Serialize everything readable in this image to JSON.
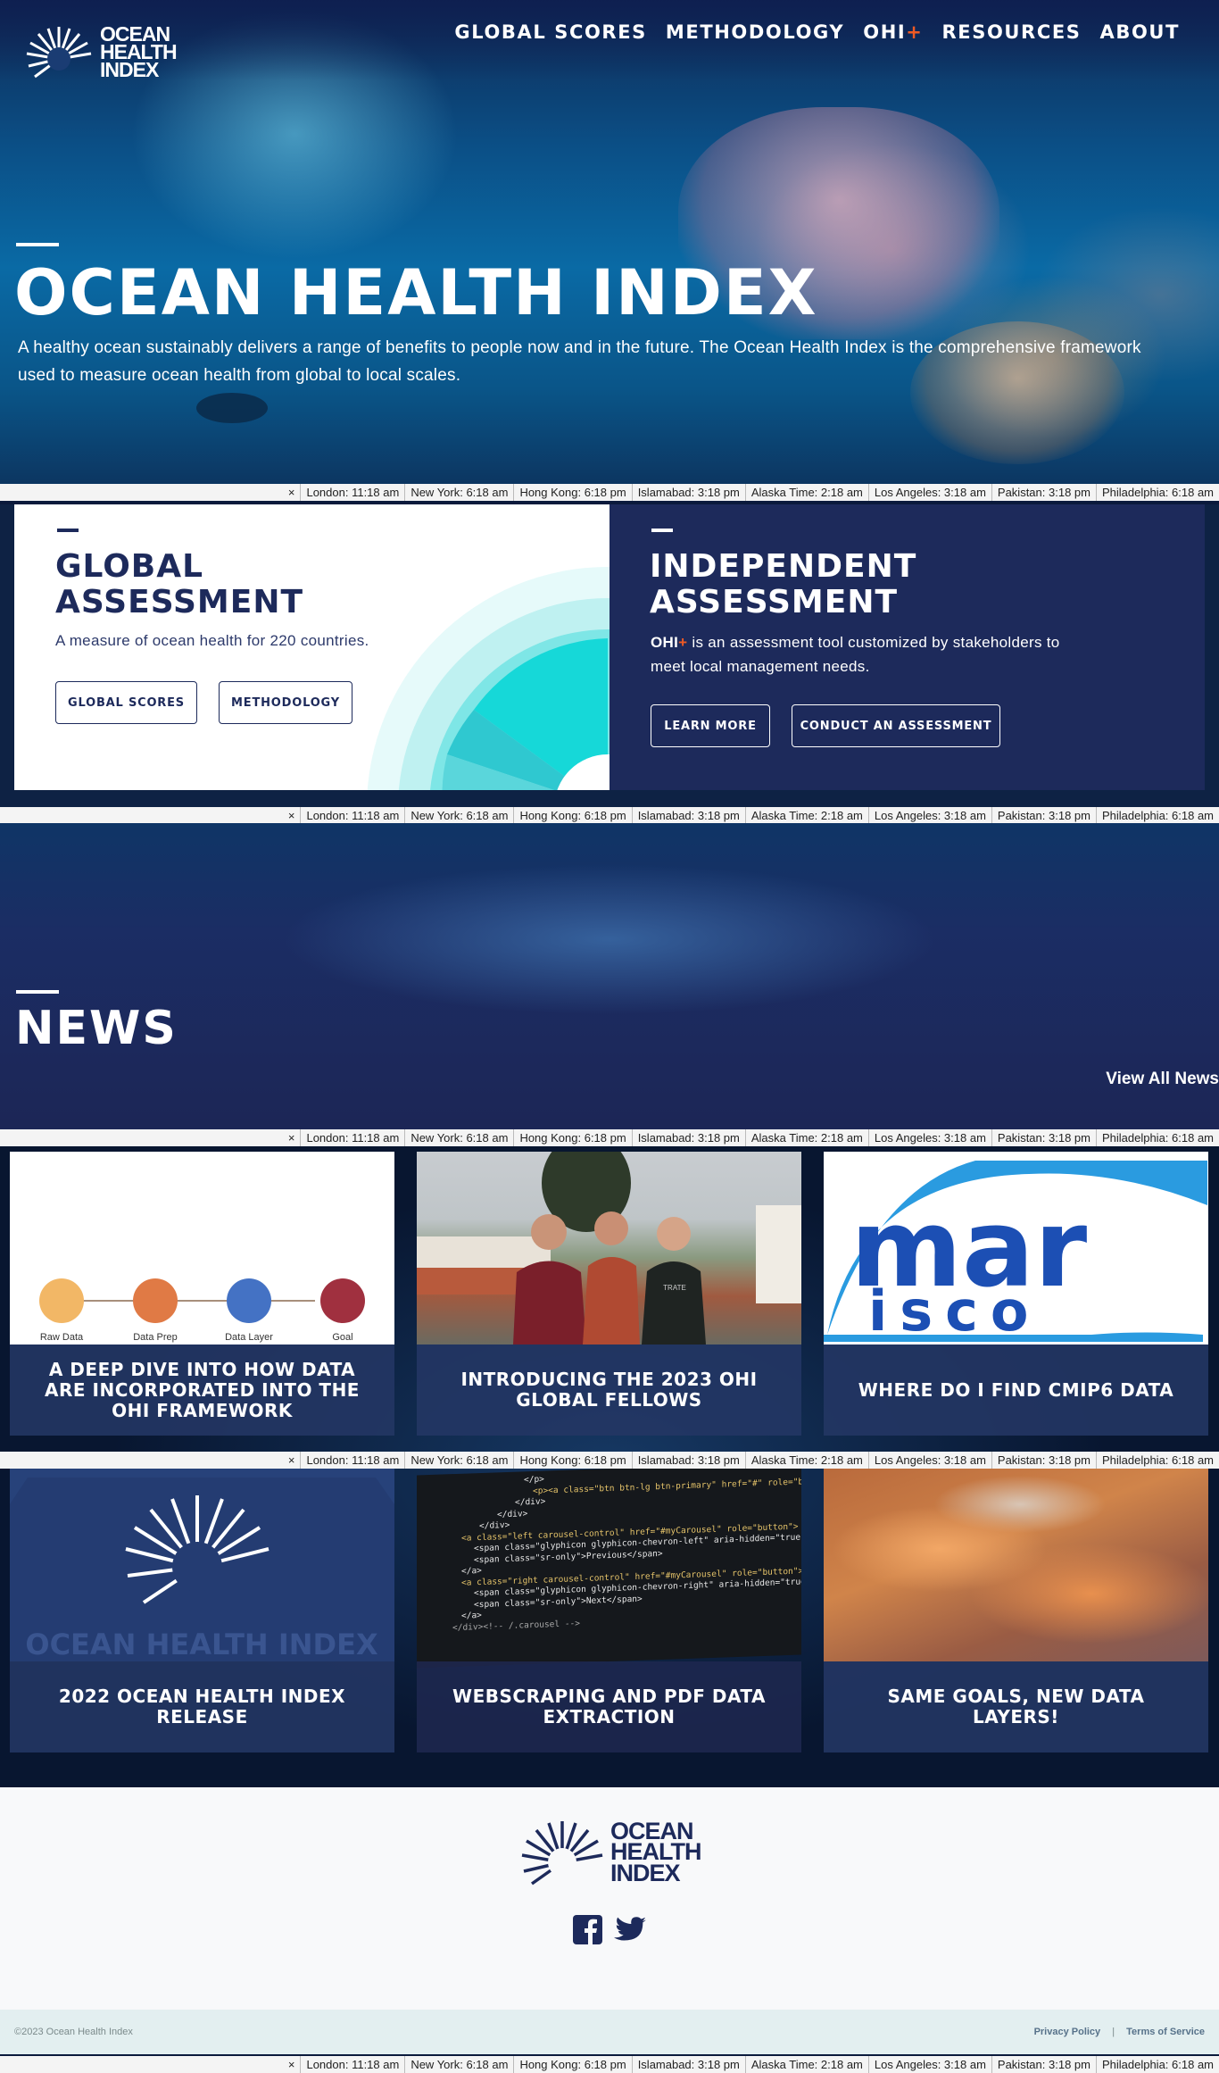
{
  "brand": {
    "logo_line1": "OCEAN",
    "logo_line2": "HEALTH",
    "logo_line3": "INDEX"
  },
  "nav": {
    "items": [
      "GLOBAL SCORES",
      "METHODOLOGY",
      "OHI",
      "RESOURCES",
      "ABOUT"
    ],
    "plus": "+"
  },
  "hero": {
    "title": "OCEAN HEALTH INDEX",
    "text": "A healthy ocean sustainably delivers a range of benefits to people now and in the future. The Ocean Health Index is the comprehensive framework used to measure ocean health from global to local scales."
  },
  "ticker": {
    "close": "×",
    "items": [
      "London: 11:18 am",
      "New York: 6:18 am",
      "Hong Kong: 6:18 pm",
      "Islamabad: 3:18 pm",
      "Alaska Time: 2:18 am",
      "Los Angeles: 3:18 am",
      "Pakistan: 3:18 pm",
      "Philadelphia: 6:18 am"
    ]
  },
  "global": {
    "title_l1": "GLOBAL",
    "title_l2": "ASSESSMENT",
    "text": "A measure of ocean health for 220 countries.",
    "btn1": "GLOBAL SCORES",
    "btn2": "METHODOLOGY"
  },
  "independent": {
    "title_l1": "INDEPENDENT",
    "title_l2": "ASSESSMENT",
    "ohi": "OHI",
    "plus": "+",
    "text": " is an assessment tool customized by stakeholders to meet local management needs.",
    "btn1": "LEARN MORE",
    "btn2": "CONDUCT AN ASSESSMENT"
  },
  "news": {
    "title": "NEWS",
    "view_all": "View All News"
  },
  "diagram": {
    "labels": [
      "Raw Data",
      "Data Prep",
      "Data Layer",
      "Goal"
    ]
  },
  "fellows_image_text": "TRATE",
  "code_image_lines": [
    "</p>",
    "<p><a class=\"btn btn-lg btn-primary\" href=\"#\" role=\"button\">",
    "</div>",
    "</div>",
    "</div>",
    "<a class=\"left carousel-control\" href=\"#myCarousel\" role=\"button\">",
    "<span class=\"glyphicon glyphicon-chevron-left\" aria-hidden=\"true\"></span>",
    "<span class=\"sr-only\">Previous</span>",
    "</a>",
    "<a class=\"right carousel-control\" href=\"#myCarousel\" role=\"button\">",
    "<span class=\"glyphicon glyphicon-chevron-right\" aria-hidden=\"true\"></span>",
    "<span class=\"sr-only\">Next</span>",
    "</a>",
    "</div><!-- /.carousel -->"
  ],
  "marisco": {
    "l1": "mar",
    "l2": "isco"
  },
  "ohi_release_image_text": "OCEAN HEALTH INDEX",
  "posts": [
    {
      "title": "A DEEP DIVE INTO HOW DATA ARE INCORPORATED INTO THE OHI FRAMEWORK"
    },
    {
      "title": "INTRODUCING THE 2023 OHI GLOBAL FELLOWS"
    },
    {
      "title": "WHERE DO I FIND CMIP6 DATA"
    },
    {
      "title": "2022 OCEAN HEALTH INDEX RELEASE"
    },
    {
      "title": "WEBSCRAPING AND PDF DATA EXTRACTION"
    },
    {
      "title": "SAME GOALS, NEW DATA LAYERS!"
    }
  ],
  "footer": {
    "copyright": "©2023 Ocean Health Index",
    "privacy": "Privacy Policy",
    "sep": "|",
    "terms": "Terms of Service"
  },
  "colors": {
    "navy": "#1d2a5b",
    "accent": "#ef5a24",
    "teal": "#16d8d8",
    "footer_bg": "#f8f9fa",
    "subfooter_bg": "#e3eff0"
  }
}
